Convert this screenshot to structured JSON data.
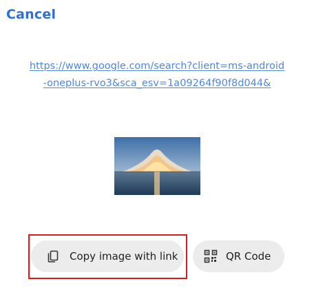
{
  "header": {
    "cancel_label": "Cancel"
  },
  "share": {
    "url_line1": "https://www.google.com/search?client=ms-android",
    "url_line2": "-oneplus-rvo3&sca_esv=1a09264f90f8d044&"
  },
  "actions": {
    "copy_image_label": "Copy image with link",
    "qr_code_label": "QR Code"
  },
  "icons": {
    "copy": "copy-icon",
    "qr": "qr-code-icon"
  },
  "colors": {
    "link": "#4d86e3",
    "cancel": "#2f6fd6",
    "pill_bg": "#ececec",
    "highlight": "#e21818"
  }
}
